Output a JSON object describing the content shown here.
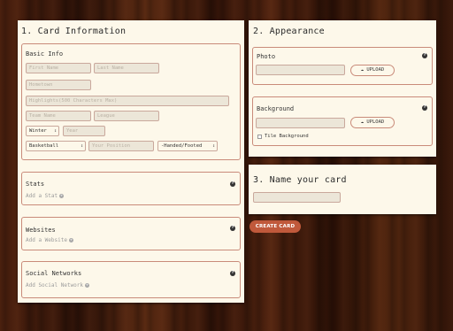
{
  "card_info": {
    "heading": "1. Card Information",
    "basic_info": {
      "label": "Basic Info",
      "first_name_placeholder": "First Name",
      "last_name_placeholder": "Last Name",
      "hometown_placeholder": "Hometown",
      "highlights_placeholder": "Highlights(500 Characters Max)",
      "team_name_placeholder": "Team Name",
      "league_placeholder": "League",
      "season_value": "Winter",
      "year_placeholder": "Year",
      "sport_value": "Basketball",
      "position_placeholder": "Your Position",
      "handed_value": "-Handed/Footed"
    },
    "stats": {
      "label": "Stats",
      "add_label": "Add a Stat"
    },
    "websites": {
      "label": "Websites",
      "add_label": "Add a Website"
    },
    "social": {
      "label": "Social Networks",
      "add_label": "Add Social Network"
    }
  },
  "appearance": {
    "heading": "2. Appearance",
    "photo": {
      "label": "Photo",
      "upload_label": "UPLOAD"
    },
    "background": {
      "label": "Background",
      "upload_label": "UPLOAD",
      "tile_label": "Tile Background"
    }
  },
  "name_card": {
    "heading": "3. Name your card"
  },
  "create_button": "CREATE CARD",
  "icons": {
    "help": "question-circle-icon",
    "add": "plus-circle-icon",
    "upload": "cloud-upload-icon"
  },
  "colors": {
    "accent": "#c0593b",
    "panel": "#fdf8ea",
    "border": "#c98b7a"
  }
}
